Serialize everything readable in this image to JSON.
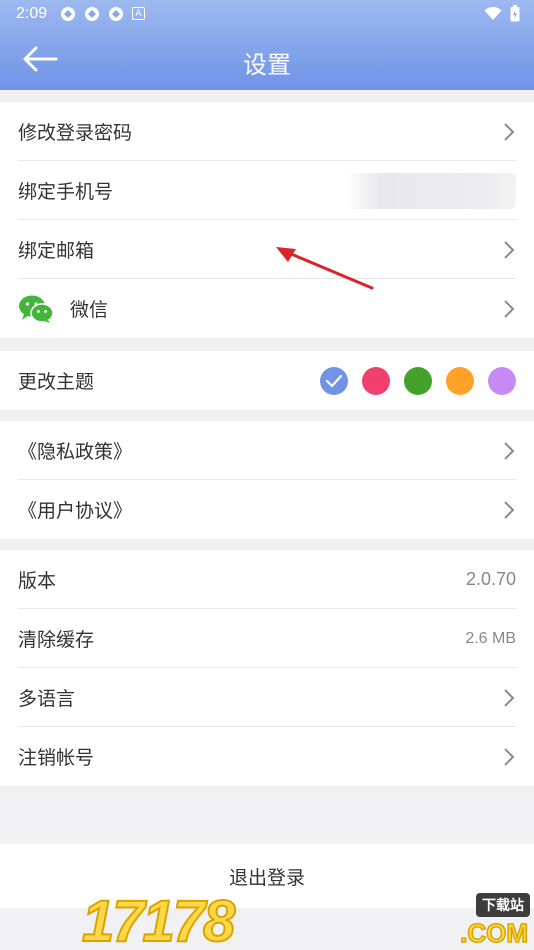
{
  "status_bar": {
    "time": "2:09",
    "notif_letter": "A"
  },
  "header": {
    "title": "设置"
  },
  "account": {
    "change_password": "修改登录密码",
    "bind_phone": "绑定手机号",
    "bind_email": "绑定邮箱",
    "wechat": "微信"
  },
  "theme": {
    "label": "更改主题",
    "colors": [
      "#6f93e6",
      "#f2406e",
      "#44a22b",
      "#ffa227",
      "#c58af4"
    ],
    "selected_index": 0
  },
  "legal": {
    "privacy": "《隐私政策》",
    "agreement": "《用户协议》"
  },
  "app": {
    "version_label": "版本",
    "version_value": "2.0.70",
    "cache_label": "清除缓存",
    "cache_value": "2.6 MB",
    "language_label": "多语言",
    "delete_account_label": "注销帐号"
  },
  "logout_label": "退出登录",
  "watermark": {
    "digits": "17178",
    "badge": "下载站",
    "com": ".COM"
  },
  "colors": {
    "header_top": "#9eb9f0",
    "header_bottom": "#6f93e6",
    "annotation_arrow": "#d9242a"
  }
}
